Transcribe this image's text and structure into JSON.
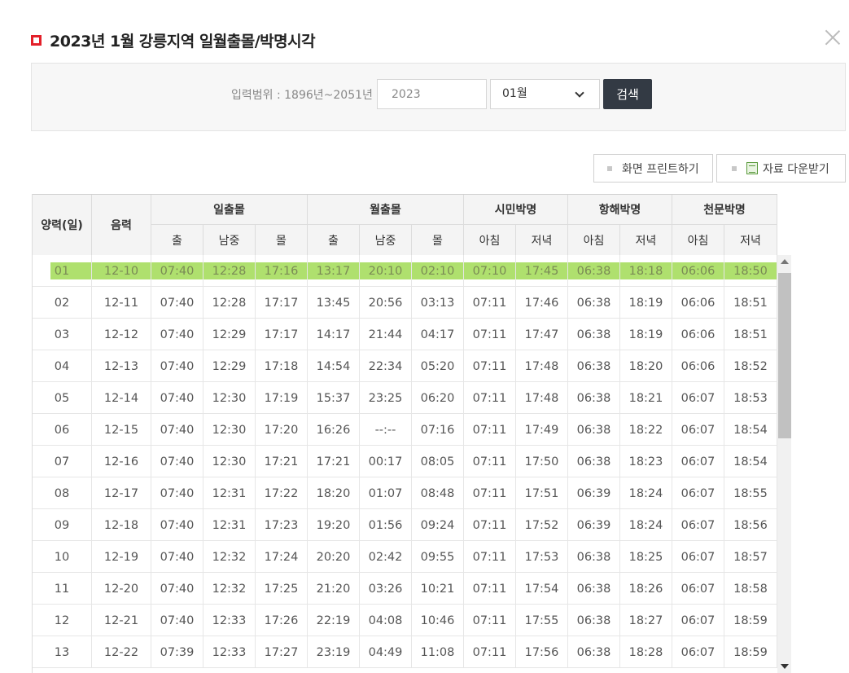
{
  "title": "2023년 1월 강릉지역 일월출몰/박명시각",
  "search": {
    "range_label": "입력범위 : 1896년~2051년",
    "year_value": "2023",
    "month_value": "01월",
    "button": "검색"
  },
  "actions": {
    "print": "화면 프린트하기",
    "download": "자료 다운받기"
  },
  "table": {
    "headers": {
      "solar": "양력(일)",
      "lunar": "음력",
      "sun": "일출몰",
      "moon": "월출몰",
      "civil": "시민박명",
      "nautical": "항해박명",
      "astro": "천문박명",
      "rise": "출",
      "transit": "남중",
      "set": "몰",
      "morning": "아침",
      "evening": "저녁"
    },
    "rows": [
      [
        "01",
        "12-10",
        "07:40",
        "12:28",
        "17:16",
        "13:17",
        "20:10",
        "02:10",
        "07:10",
        "17:45",
        "06:38",
        "18:18",
        "06:06",
        "18:50"
      ],
      [
        "02",
        "12-11",
        "07:40",
        "12:28",
        "17:17",
        "13:45",
        "20:56",
        "03:13",
        "07:11",
        "17:46",
        "06:38",
        "18:19",
        "06:06",
        "18:51"
      ],
      [
        "03",
        "12-12",
        "07:40",
        "12:29",
        "17:17",
        "14:17",
        "21:44",
        "04:17",
        "07:11",
        "17:47",
        "06:38",
        "18:19",
        "06:06",
        "18:51"
      ],
      [
        "04",
        "12-13",
        "07:40",
        "12:29",
        "17:18",
        "14:54",
        "22:34",
        "05:20",
        "07:11",
        "17:48",
        "06:38",
        "18:20",
        "06:06",
        "18:52"
      ],
      [
        "05",
        "12-14",
        "07:40",
        "12:30",
        "17:19",
        "15:37",
        "23:25",
        "06:20",
        "07:11",
        "17:48",
        "06:38",
        "18:21",
        "06:07",
        "18:53"
      ],
      [
        "06",
        "12-15",
        "07:40",
        "12:30",
        "17:20",
        "16:26",
        "--:--",
        "07:16",
        "07:11",
        "17:49",
        "06:38",
        "18:22",
        "06:07",
        "18:54"
      ],
      [
        "07",
        "12-16",
        "07:40",
        "12:30",
        "17:21",
        "17:21",
        "00:17",
        "08:05",
        "07:11",
        "17:50",
        "06:38",
        "18:23",
        "06:07",
        "18:54"
      ],
      [
        "08",
        "12-17",
        "07:40",
        "12:31",
        "17:22",
        "18:20",
        "01:07",
        "08:48",
        "07:11",
        "17:51",
        "06:39",
        "18:24",
        "06:07",
        "18:55"
      ],
      [
        "09",
        "12-18",
        "07:40",
        "12:31",
        "17:23",
        "19:20",
        "01:56",
        "09:24",
        "07:11",
        "17:52",
        "06:39",
        "18:24",
        "06:07",
        "18:56"
      ],
      [
        "10",
        "12-19",
        "07:40",
        "12:32",
        "17:24",
        "20:20",
        "02:42",
        "09:55",
        "07:11",
        "17:53",
        "06:38",
        "18:25",
        "06:07",
        "18:57"
      ],
      [
        "11",
        "12-20",
        "07:40",
        "12:32",
        "17:25",
        "21:20",
        "03:26",
        "10:21",
        "07:11",
        "17:54",
        "06:38",
        "18:26",
        "06:07",
        "18:58"
      ],
      [
        "12",
        "12-21",
        "07:40",
        "12:33",
        "17:26",
        "22:19",
        "04:08",
        "10:46",
        "07:11",
        "17:55",
        "06:38",
        "18:27",
        "06:07",
        "18:59"
      ],
      [
        "13",
        "12-22",
        "07:39",
        "12:33",
        "17:27",
        "23:19",
        "04:49",
        "11:08",
        "07:11",
        "17:56",
        "06:38",
        "18:28",
        "06:07",
        "18:59"
      ]
    ]
  }
}
